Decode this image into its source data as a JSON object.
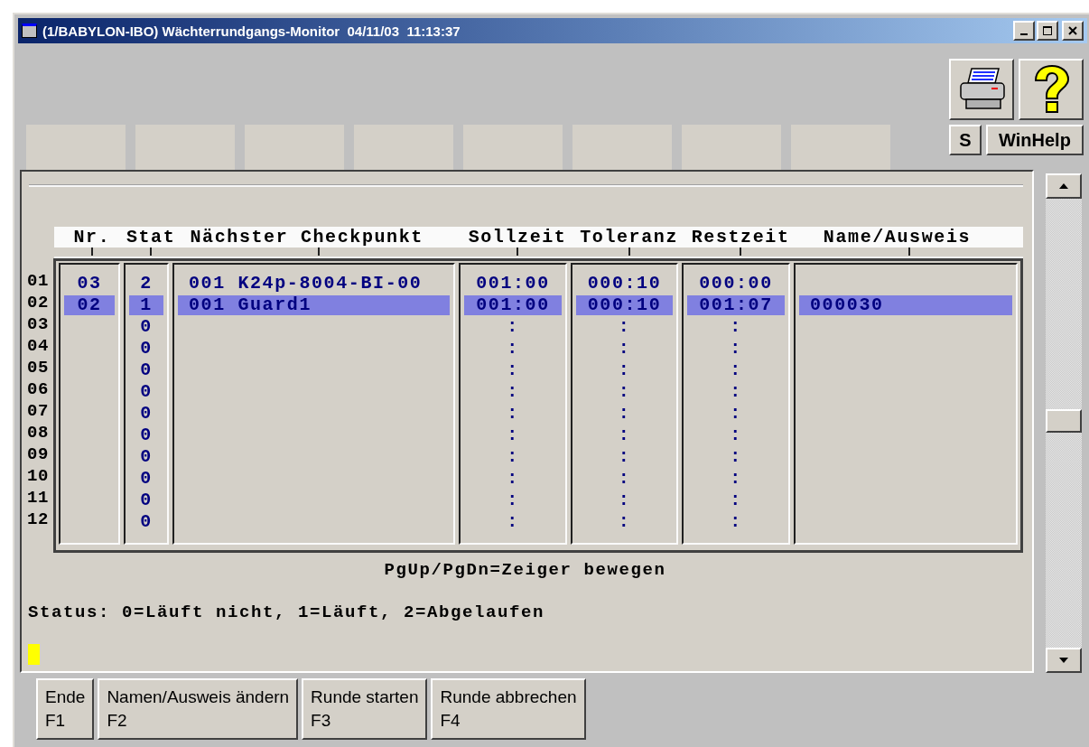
{
  "window": {
    "title": "(1/BABYLON-IBO) Wächterrundgangs-Monitor  04/11/03  11:13:37"
  },
  "toolbar": {
    "icon_buttons": [
      {
        "kind": "print"
      },
      {
        "kind": "help"
      }
    ],
    "text_buttons": [
      "S",
      "WinHelp"
    ]
  },
  "table": {
    "columns": [
      {
        "label": "Nr."
      },
      {
        "label": "Stat"
      },
      {
        "label": "Nächster Checkpunkt"
      },
      {
        "label": "Sollzeit"
      },
      {
        "label": "Toleranz"
      },
      {
        "label": "Restzeit"
      },
      {
        "label": "Name/Ausweis"
      }
    ],
    "rows": [
      {
        "label": "01",
        "selected": false,
        "cells": [
          "03",
          "2",
          "001 K24p-8004-BI-00",
          "001:00",
          "000:10",
          "000:00",
          null
        ]
      },
      {
        "label": "02",
        "selected": true,
        "cells": [
          "02",
          "1",
          "001 Guard1",
          "001:00",
          "000:10",
          "001:07",
          "000030"
        ]
      },
      {
        "label": "03",
        "selected": false,
        "cells": [
          null,
          "0",
          null,
          ":",
          ":",
          ":",
          null
        ]
      },
      {
        "label": "04",
        "selected": false,
        "cells": [
          null,
          "0",
          null,
          ":",
          ":",
          ":",
          null
        ]
      },
      {
        "label": "05",
        "selected": false,
        "cells": [
          null,
          "0",
          null,
          ":",
          ":",
          ":",
          null
        ]
      },
      {
        "label": "06",
        "selected": false,
        "cells": [
          null,
          "0",
          null,
          ":",
          ":",
          ":",
          null
        ]
      },
      {
        "label": "07",
        "selected": false,
        "cells": [
          null,
          "0",
          null,
          ":",
          ":",
          ":",
          null
        ]
      },
      {
        "label": "08",
        "selected": false,
        "cells": [
          null,
          "0",
          null,
          ":",
          ":",
          ":",
          null
        ]
      },
      {
        "label": "09",
        "selected": false,
        "cells": [
          null,
          "0",
          null,
          ":",
          ":",
          ":",
          null
        ]
      },
      {
        "label": "10",
        "selected": false,
        "cells": [
          null,
          "0",
          null,
          ":",
          ":",
          ":",
          null
        ]
      },
      {
        "label": "11",
        "selected": false,
        "cells": [
          null,
          "0",
          null,
          ":",
          ":",
          ":",
          null
        ]
      },
      {
        "label": "12",
        "selected": false,
        "cells": [
          null,
          "0",
          null,
          ":",
          ":",
          ":",
          null
        ]
      }
    ]
  },
  "hint": "PgUp/PgDn=Zeiger bewegen",
  "status_legend": "Status: 0=Läuft nicht, 1=Läuft, 2=Abgelaufen",
  "function_keys": [
    {
      "label": "Ende",
      "key": "F1"
    },
    {
      "label": "Namen/Ausweis ändern",
      "key": "F2"
    },
    {
      "label": "Runde starten",
      "key": "F3"
    },
    {
      "label": "Runde abbrechen",
      "key": "F4"
    }
  ]
}
